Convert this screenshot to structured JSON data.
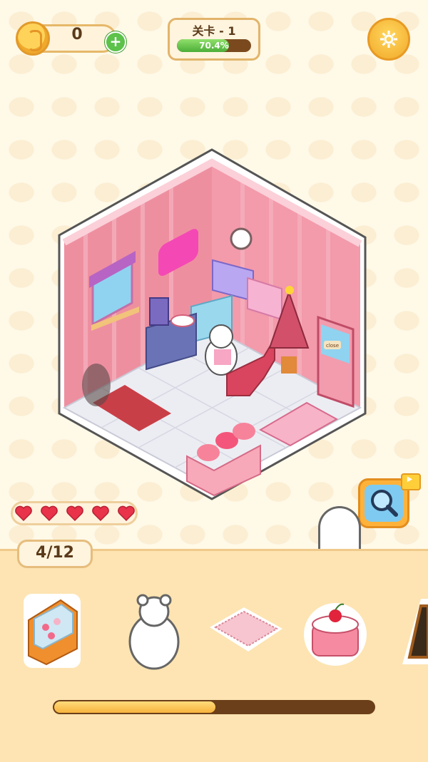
{
  "hud": {
    "coins": "0",
    "plus_label": "+",
    "level_title": "关卡 - 1",
    "level_progress_text": "70.4%",
    "level_progress": 0.704
  },
  "lives": {
    "count": 5
  },
  "found_counter": "4/12",
  "collection_progress": 0.505,
  "tray_items": [
    "pastry-display-case-icon",
    "polar-bear-icon",
    "pink-rug-icon",
    "cherry-cake-icon",
    "chalkboard-sign-icon"
  ],
  "room_sign": "close",
  "colors": {
    "accent": "#f1a92a",
    "panel": "#fde4b2",
    "heart": "#e8334a",
    "progress_green": "#4cae38"
  }
}
